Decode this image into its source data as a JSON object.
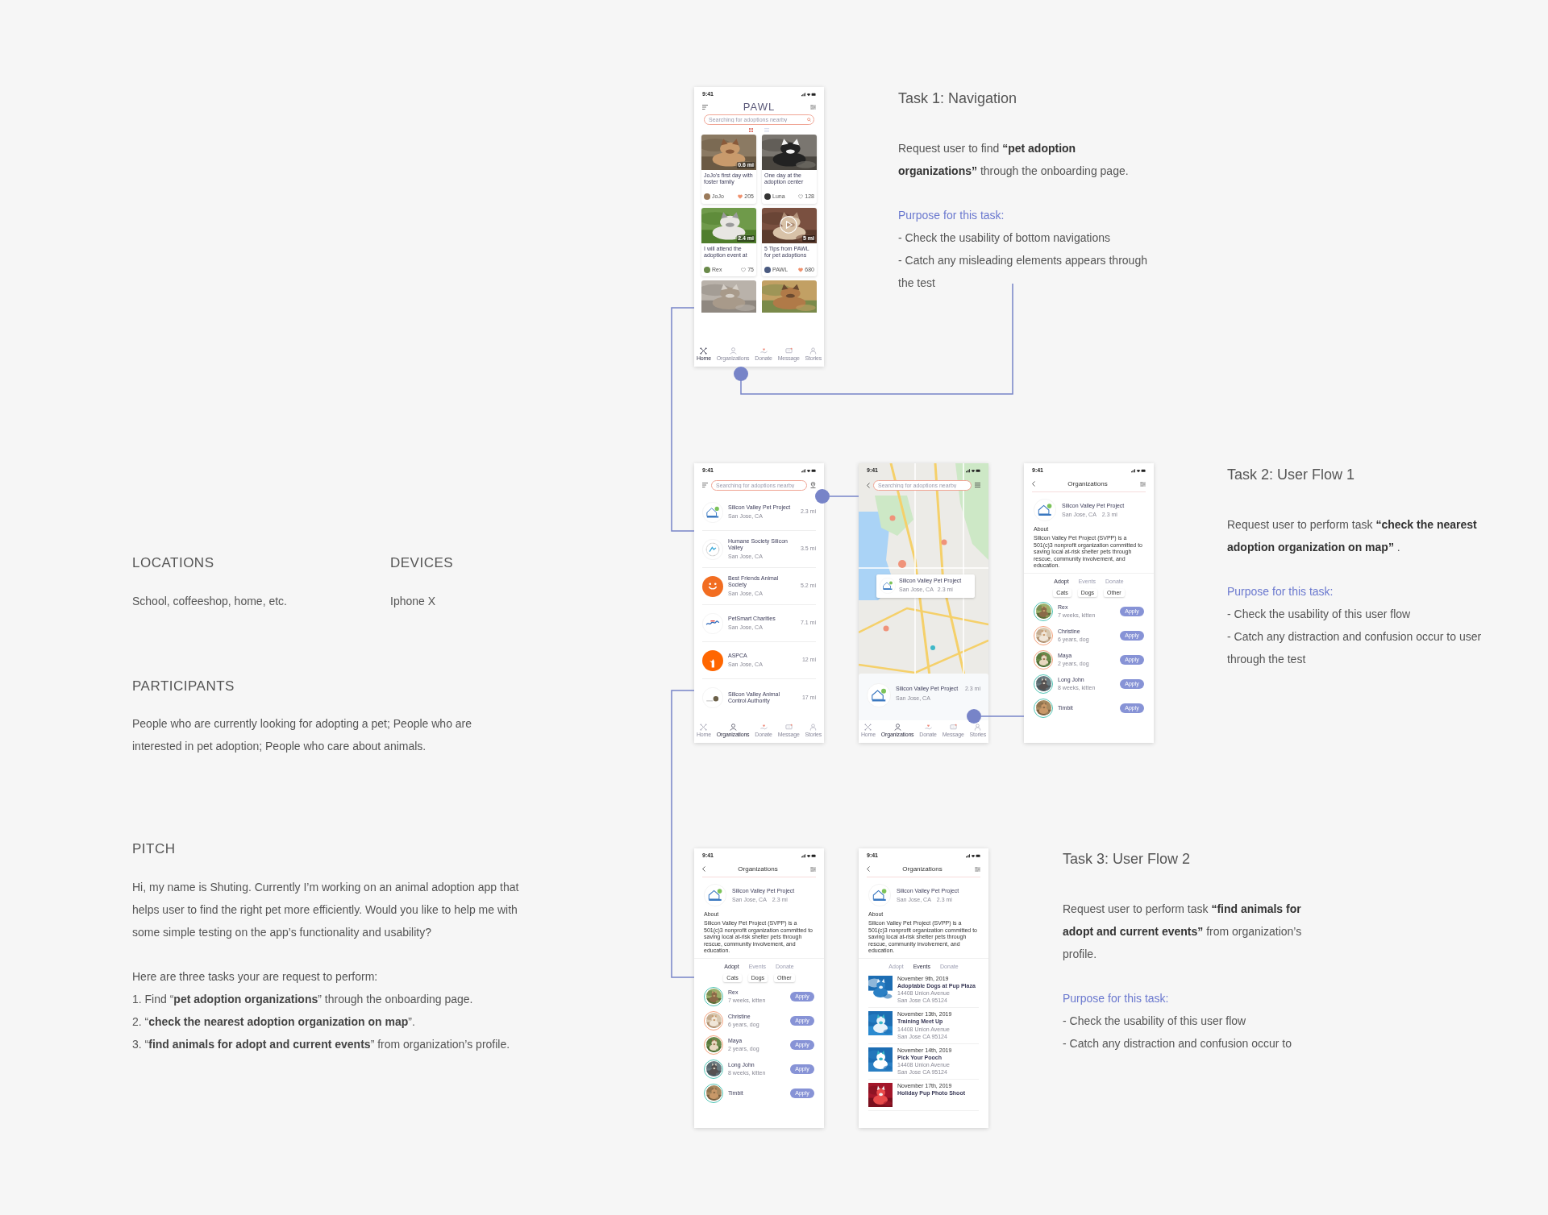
{
  "info": {
    "facts": [
      {
        "heading": "LOCATIONS",
        "text": "School, coffeeshop, home, etc."
      },
      {
        "heading": "DEVICES",
        "text": "Iphone X"
      }
    ],
    "participants": {
      "heading": "PARTICIPANTS",
      "text": "People who are currently looking for adopting a pet; People who are interested in pet adoption; People who care about animals."
    },
    "pitch": {
      "heading": "PITCH",
      "paragraphs": [
        "Hi, my name is Shuting. Currently I’m working on an animal adoption app that helps user to find the right pet more efficiently. Would you like to help me with some simple testing on the app’s functionality and usability?",
        "Here are three tasks your are request to perform:"
      ],
      "tasks": [
        "1. Find “**pet adoption organizations**” through the onboarding page.",
        "2. “**check the nearest adoption organization on map**”.",
        "3. “**find animals for adopt and current events**” from organization’s profile."
      ]
    }
  },
  "tasks": [
    {
      "title": "Task 1: Navigation",
      "request": "Request user to find **“pet adoption organizations”** through the onboarding page.",
      "purpose_heading": "Purpose for this task:",
      "purpose": [
        "- Check the usability of bottom navigations",
        "- Catch any misleading elements appears through the test"
      ]
    },
    {
      "title": "Task 2: User Flow 1",
      "request": "Request user to perform task **“check the nearest adoption organization on map”** .",
      "purpose_heading": "Purpose for this task:",
      "purpose": [
        "- Check the usability of this user flow",
        "- Catch any distraction and confusion occur to user through the test"
      ]
    },
    {
      "title": "Task 3: User Flow 2",
      "request": "Request user to perform task **“find animals for adopt and current events”** from organization’s profile.",
      "purpose_heading": "Purpose for this task:",
      "purpose": [
        "- Check the usability of this user flow",
        "- Catch any distraction and confusion occur to"
      ]
    }
  ],
  "screens": [
    {
      "kind": "home",
      "time": "9:41",
      "logo": "PAWL",
      "search_placeholder": "Searching for adoptions nearby",
      "view_toggle": [
        {
          "kind": "grid",
          "selected": true
        },
        {
          "kind": "list",
          "selected": false
        }
      ],
      "cards": [
        {
          "kind": "post",
          "title": "JoJo’s first day with foster family",
          "author": "JoJo",
          "likes": "205",
          "liked": true,
          "badge": "0.6 mi"
        },
        {
          "kind": "post",
          "title": "One day at the adoption center",
          "author": "Luna",
          "likes": "128",
          "liked": false
        },
        {
          "kind": "post",
          "title": "I will attend the adoption event at",
          "author": "Rex",
          "likes": "75",
          "liked": false,
          "badge": "2.4 mi"
        },
        {
          "kind": "post",
          "title": "5 Tips from PAWL for pet adoptions",
          "author": "PAWL",
          "likes": "680",
          "liked": true,
          "badge": "5 mi",
          "video": true
        },
        {
          "kind": "picture"
        },
        {
          "kind": "picture"
        }
      ],
      "nav": [
        {
          "label": "Home",
          "selected": true
        },
        {
          "label": "Organizations",
          "selected": false
        },
        {
          "label": "Donate",
          "selected": false
        },
        {
          "label": "Message",
          "selected": false
        },
        {
          "label": "Stories",
          "selected": false
        }
      ]
    },
    {
      "kind": "org_list",
      "time": "9:41",
      "search_placeholder": "Searching for adoptions nearby",
      "orgs": [
        {
          "name": "Silicon Valley Pet Project",
          "city": "San Jose, CA",
          "distance": "2.3 mi"
        },
        {
          "name": "Humane Society Silicon Valley",
          "city": "San Jose, CA",
          "distance": "3.5 mi"
        },
        {
          "name": "Best Friends Animal Society",
          "city": "San Jose, CA",
          "distance": "5.2 mi"
        },
        {
          "name": "PetSmart Charities",
          "city": "San Jose, CA",
          "distance": "7.1 mi"
        },
        {
          "name": "ASPCA",
          "city": "San Jose, CA",
          "distance": "12 mi"
        },
        {
          "name": "Silicon Valley Animal Control Authority",
          "distance": "17 mi"
        }
      ],
      "nav": [
        {
          "label": "Home",
          "selected": false
        },
        {
          "label": "Organizations",
          "selected": true
        },
        {
          "label": "Donate",
          "selected": false
        },
        {
          "label": "Message",
          "selected": false
        },
        {
          "label": "Stories",
          "selected": false
        }
      ]
    },
    {
      "kind": "map",
      "time": "9:41",
      "search_placeholder": "Searching for adoptions nearby",
      "popup": {
        "name": "Silicon Valley Pet Project",
        "city": "San Jose, CA",
        "distance": "2.3 mi"
      },
      "card": {
        "name": "Silicon Valley Pet Project",
        "city": "San Jose, CA",
        "distance": "2.3 mi"
      },
      "nav": [
        {
          "label": "Home",
          "selected": false
        },
        {
          "label": "Organizations",
          "selected": true
        },
        {
          "label": "Donate",
          "selected": false
        },
        {
          "label": "Message",
          "selected": false
        },
        {
          "label": "Stories",
          "selected": false
        }
      ]
    },
    {
      "kind": "org_detail",
      "time": "9:41",
      "header": "Organizations",
      "org": {
        "name": "Silicon Valley Pet Project",
        "city": "San Jose, CA",
        "distance": "2.3 mi"
      },
      "about_heading": "About",
      "about": "Silicon Valley Pet Project (SVPP) is a 501(c)3 nonprofit organization committed to saving local at-risk shelter pets through rescue, community involvement, and education.",
      "tabs": [
        {
          "label": "Adopt",
          "selected": true
        },
        {
          "label": "Events",
          "selected": false
        },
        {
          "label": "Donate",
          "selected": false
        }
      ],
      "filters": [
        "Cats",
        "Dogs",
        "Other"
      ],
      "animals": [
        {
          "name": "Rex",
          "details": "7 weeks, kitten",
          "color": "#4fc4b4",
          "action": "Apply"
        },
        {
          "name": "Christine",
          "details": "6 years, dog",
          "color": "#f4a27c",
          "action": "Apply"
        },
        {
          "name": "Maya",
          "details": "2 years, dog",
          "color": "#f4a27c",
          "action": "Apply"
        },
        {
          "name": "Long John",
          "details": "8 weeks, kitten",
          "color": "#4fc4b4",
          "action": "Apply"
        },
        {
          "name": "Timbit",
          "color": "#4fc4b4",
          "action": "Apply"
        }
      ]
    },
    {
      "kind": "org_detail",
      "time": "9:41",
      "header": "Organizations",
      "org": {
        "name": "Silicon Valley Pet Project",
        "city": "San Jose, CA",
        "distance": "2.3 mi"
      },
      "about_heading": "About",
      "about": "Silicon Valley Pet Project (SVPP) is a 501(c)3 nonprofit organization committed to saving local at-risk shelter pets through rescue, community involvement, and education.",
      "tabs": [
        {
          "label": "Adopt",
          "selected": true
        },
        {
          "label": "Events",
          "selected": false
        },
        {
          "label": "Donate",
          "selected": false
        }
      ],
      "filters": [
        "Cats",
        "Dogs",
        "Other"
      ],
      "animals": [
        {
          "name": "Rex",
          "details": "7 weeks, kitten",
          "color": "#4fc4b4",
          "action": "Apply"
        },
        {
          "name": "Christine",
          "details": "6 years, dog",
          "color": "#f4a27c",
          "action": "Apply"
        },
        {
          "name": "Maya",
          "details": "2 years, dog",
          "color": "#f4a27c",
          "action": "Apply"
        },
        {
          "name": "Long John",
          "details": "8 weeks, kitten",
          "color": "#4fc4b4",
          "action": "Apply"
        },
        {
          "name": "Timbit",
          "color": "#4fc4b4",
          "action": "Apply"
        }
      ]
    },
    {
      "kind": "org_detail",
      "time": "9:41",
      "header": "Organizations",
      "org": {
        "name": "Silicon Valley Pet Project",
        "city": "San Jose, CA",
        "distance": "2.3 mi"
      },
      "about_heading": "About",
      "about": "Silicon Valley Pet Project (SVPP) is a 501(c)3 nonprofit organization committed to saving local at-risk shelter pets through rescue, community involvement, and education.",
      "tabs": [
        {
          "label": "Adopt",
          "selected": false
        },
        {
          "label": "Events",
          "selected": true
        },
        {
          "label": "Donate",
          "selected": false
        }
      ],
      "events": [
        {
          "date": "November 9th, 2019",
          "title": "Adoptable Dogs at Pup Plaza",
          "address": [
            "14408 Union Avenue",
            "San Jose CA 95124"
          ]
        },
        {
          "date": "November 13th, 2019",
          "title": "Training Meet Up",
          "address": [
            "14408 Union Avenue",
            "San Jose CA 95124"
          ]
        },
        {
          "date": "November 14th, 2019",
          "title": "Pick Your Pooch",
          "address": [
            "14408 Union Avenue",
            "San Jose CA 95124"
          ]
        },
        {
          "date": "November 17th, 2019",
          "title": "Holiday Pup Photo Shoot"
        }
      ]
    }
  ]
}
